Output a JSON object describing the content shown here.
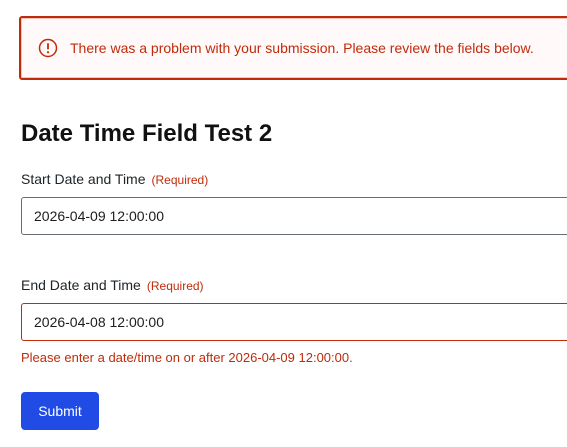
{
  "colors": {
    "error": "#c02b0a",
    "error_background": "#fff9f9",
    "primary_button": "#204ce5",
    "input_border": "#686e77"
  },
  "error_banner": {
    "icon": "exclamation-circle-icon",
    "message": "There was a problem with your submission. Please review the fields below."
  },
  "form": {
    "title": "Date Time Field Test 2",
    "fields": [
      {
        "label": "Start Date and Time",
        "required_label": "(Required)",
        "value": "2026-04-09 12:00:00"
      },
      {
        "label": "End Date and Time",
        "required_label": "(Required)",
        "value": "2026-04-08 12:00:00",
        "error": "Please enter a date/time on or after 2026-04-09 12:00:00."
      }
    ],
    "submit_label": "Submit"
  }
}
